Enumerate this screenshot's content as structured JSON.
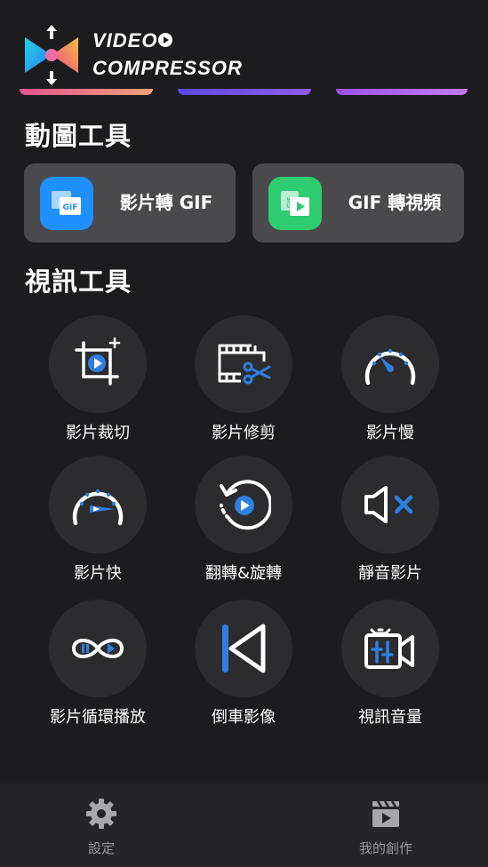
{
  "app": {
    "title_line1": "VIDEO",
    "title_line2": "COMPRESSOR",
    "logo_icon": "video-compressor-logo-icon"
  },
  "sections": {
    "gif_tools_title": "動圖工具",
    "video_tools_title": "視訊工具"
  },
  "gif_tools": [
    {
      "label": "影片轉 GIF",
      "icon": "video-to-gif-icon",
      "color": "#1e90ff"
    },
    {
      "label": "GIF 轉視頻",
      "icon": "gif-to-video-icon",
      "color": "#2ecc71"
    }
  ],
  "video_tools": [
    {
      "label": "影片裁切",
      "icon": "crop-icon"
    },
    {
      "label": "影片修剪",
      "icon": "trim-scissors-icon"
    },
    {
      "label": "影片慢",
      "icon": "slow-speedometer-icon"
    },
    {
      "label": "影片快",
      "icon": "fast-speedometer-icon"
    },
    {
      "label": "翻轉&旋轉",
      "icon": "rotate-icon"
    },
    {
      "label": "靜音影片",
      "icon": "mute-icon"
    },
    {
      "label": "影片循環播放",
      "icon": "loop-icon"
    },
    {
      "label": "倒車影像",
      "icon": "reverse-icon"
    },
    {
      "label": "視訊音量",
      "icon": "volume-adjust-icon"
    }
  ],
  "bottom_nav": {
    "settings_label": "設定",
    "creations_label": "我的創作"
  },
  "colors": {
    "background": "#1c1c1e",
    "accent_blue": "#2d7fe0",
    "circle_bg": "#2c2c2e",
    "card_bg": "#4a4a4c"
  }
}
